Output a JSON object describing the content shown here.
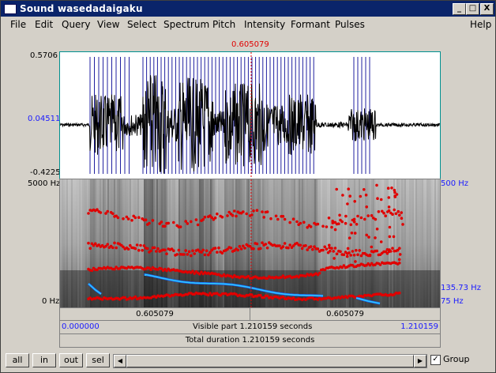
{
  "window": {
    "title": "Sound wasedadaigaku",
    "buttons": [
      "_",
      "□",
      "X"
    ]
  },
  "menu": [
    "File",
    "Edit",
    "Query",
    "View",
    "Select",
    "Spectrum",
    "Pitch",
    "Intensity",
    "Formant",
    "Pulses"
  ],
  "help": "Help",
  "cursor_time": "0.605079",
  "waveform": {
    "ymax": "0.5706",
    "ycursor": "0.04511",
    "ymin": "-0.4225"
  },
  "spectrogram": {
    "freq_max_left": "5000 Hz",
    "freq_min_left": "0 Hz",
    "pitch_max_right": "500 Hz",
    "pitch_cursor_right": "135.73 Hz",
    "pitch_min_right": "75 Hz"
  },
  "time_bar": {
    "left_segment": "0.605079",
    "right_segment": "0.605079",
    "start": "0.000000",
    "visible_part": "Visible part 1.210159 seconds",
    "end": "1.210159",
    "total": "Total duration 1.210159 seconds"
  },
  "bottom": {
    "buttons": [
      "all",
      "in",
      "out",
      "sel"
    ],
    "group_label": "Group",
    "group_checked": true
  },
  "colors": {
    "titlebar": "#0a246a",
    "formant": "#e00000",
    "pitch": "#33ccff",
    "axis_blue": "#1a1aff",
    "cursor": "#e00000"
  }
}
